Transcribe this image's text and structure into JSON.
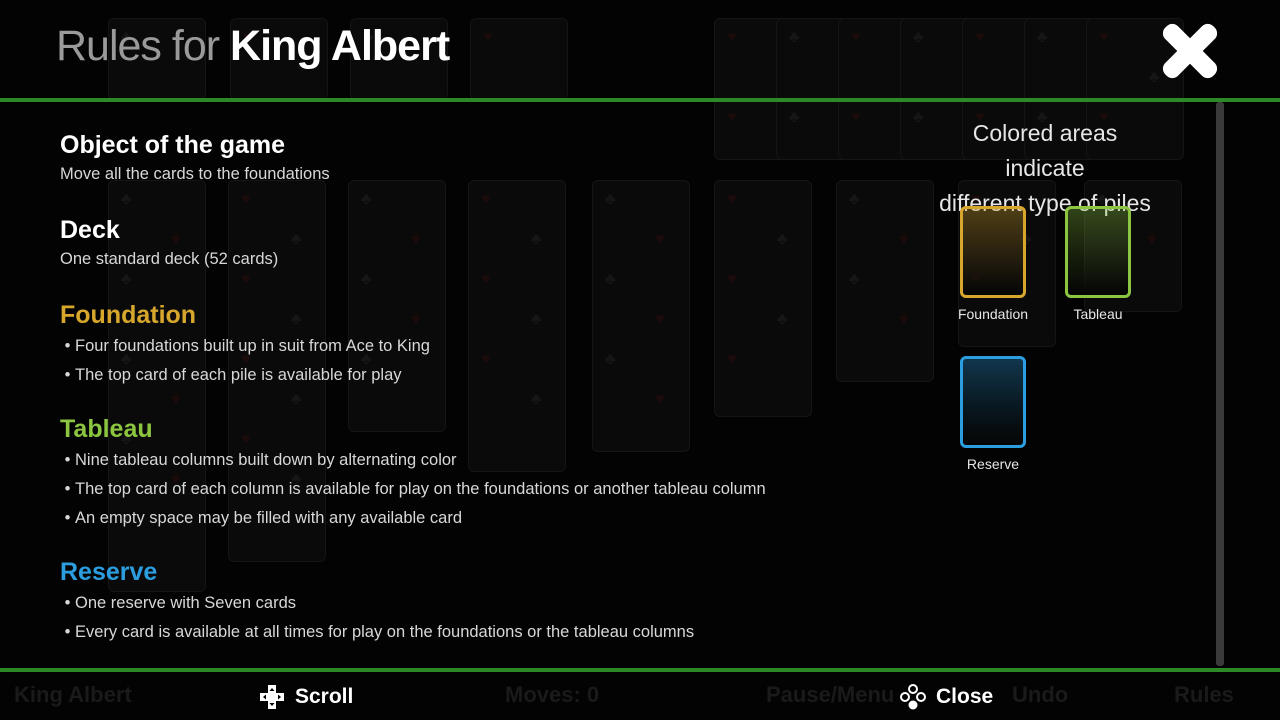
{
  "header": {
    "title_prefix": "Rules for",
    "title_name": "King Albert"
  },
  "sections": {
    "object": {
      "title": "Object of the game",
      "description": "Move all the cards to the foundations",
      "color": "#ffffff"
    },
    "deck": {
      "title": "Deck",
      "description": "One standard deck (52 cards)",
      "color": "#ffffff"
    },
    "foundation": {
      "title": "Foundation",
      "color": "#d6a72c",
      "items": [
        "Four foundations built up in suit from Ace to King",
        "The top card of each pile is available for play"
      ]
    },
    "tableau": {
      "title": "Tableau",
      "color": "#8cc540",
      "items": [
        "Nine tableau columns built down by alternating color",
        "The top card of each column is available for play on the foundations or another tableau column",
        "An empty space may be filled with any available card"
      ]
    },
    "reserve": {
      "title": "Reserve",
      "color": "#2c9ee0",
      "items": [
        "One reserve with Seven cards",
        "Every card is available at all times for play on the foundations or the tableau columns"
      ]
    }
  },
  "legend": {
    "caption_line1": "Colored areas indicate",
    "caption_line2": "different type of piles",
    "items": [
      {
        "label": "Foundation",
        "color": "#d6a72c"
      },
      {
        "label": "Tableau",
        "color": "#8cc540"
      },
      {
        "label": "Reserve",
        "color": "#2c9ee0"
      }
    ]
  },
  "footer": {
    "scroll_label": "Scroll",
    "close_label": "Close",
    "ghost_game_name": "King Albert",
    "ghost_moves": "Moves: 0",
    "ghost_pause": "Pause/Menu",
    "ghost_undo": "Undo",
    "ghost_rules": "Rules"
  },
  "colors": {
    "accent_line": "#2b8a25",
    "foundation": "#d6a72c",
    "tableau": "#8cc540",
    "reserve": "#2c9ee0"
  },
  "icons": {
    "close": "close-x-icon",
    "scroll": "dpad-icon",
    "close_action": "face-buttons-icon"
  }
}
